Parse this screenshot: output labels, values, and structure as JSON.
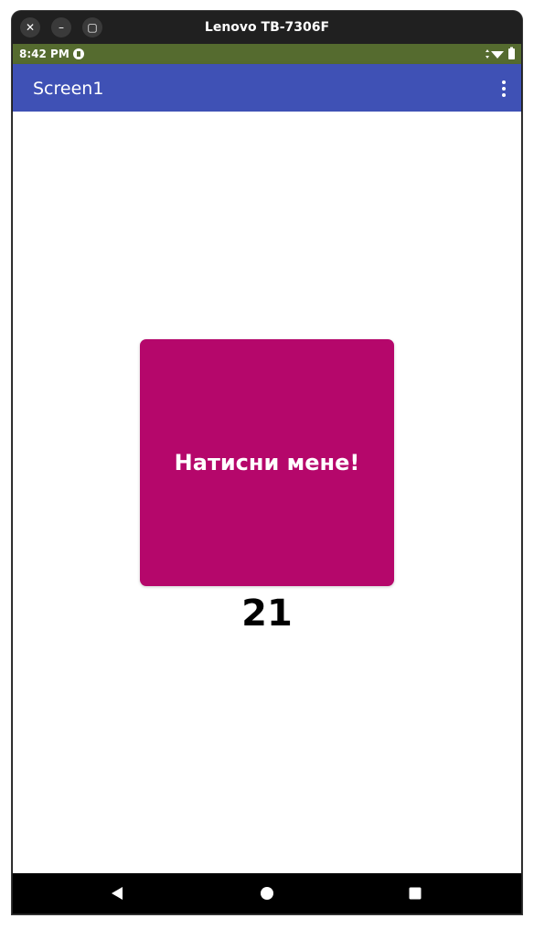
{
  "window": {
    "title": "Lenovo TB-7306F",
    "controls": {
      "close_glyph": "✕",
      "minimize_glyph": "–",
      "maximize_glyph": "▢"
    }
  },
  "status_bar": {
    "time": "8:42 PM",
    "background": "#556b2f",
    "icons": [
      "app-notification-icon",
      "data-arrows-icon",
      "wifi-icon",
      "battery-icon"
    ]
  },
  "app_bar": {
    "title": "Screen1",
    "background": "#3f51b5",
    "overflow_icon": "overflow-menu-icon"
  },
  "main": {
    "button_label": "Натисни мене!",
    "button_color": "#b5076b",
    "counter": "21"
  },
  "nav_bar": {
    "icons": [
      "back-icon",
      "home-icon",
      "recents-icon"
    ]
  }
}
